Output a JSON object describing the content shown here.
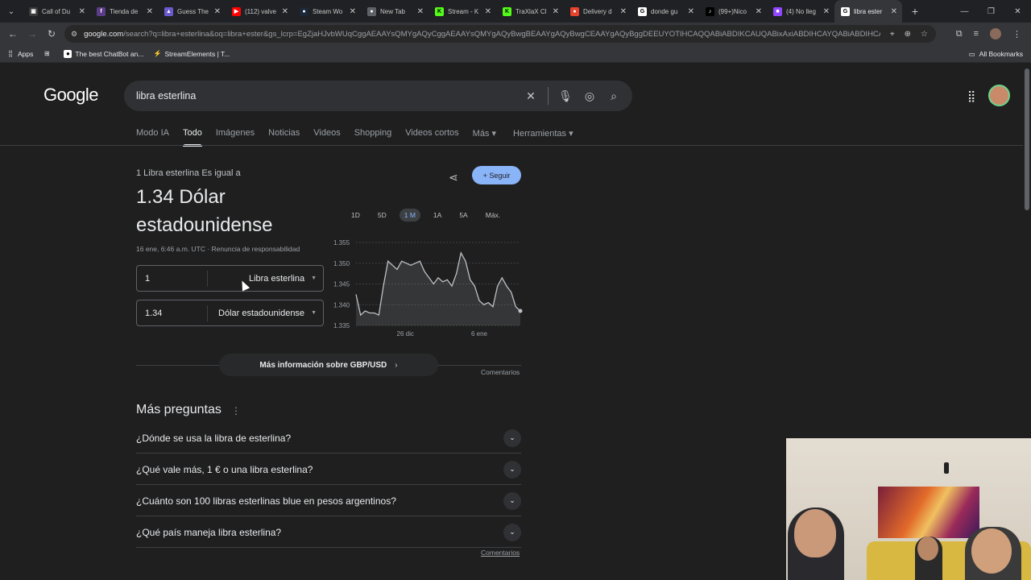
{
  "tabs": [
    {
      "title": "Call of Du",
      "favicon_color": "#3a3a3a",
      "glyph": "▣"
    },
    {
      "title": "Tienda de",
      "favicon_color": "#5b3c88",
      "glyph": "f"
    },
    {
      "title": "Guess The",
      "favicon_color": "#6a5acd",
      "glyph": "▲"
    },
    {
      "title": "(112) valve",
      "favicon_color": "#ff0000",
      "glyph": "▶"
    },
    {
      "title": "Steam Wo",
      "favicon_color": "#1b2838",
      "glyph": "●"
    },
    {
      "title": "New Tab",
      "favicon_color": "#5f6368",
      "glyph": "●"
    },
    {
      "title": "Stream - K",
      "favicon_color": "#53fc18",
      "glyph": "K"
    },
    {
      "title": "TraXlaX Cl",
      "favicon_color": "#53fc18",
      "glyph": "K"
    },
    {
      "title": "Delivery d",
      "favicon_color": "#e8432e",
      "glyph": "●"
    },
    {
      "title": "donde gu",
      "favicon_color": "#ffffff",
      "glyph": "G"
    },
    {
      "title": "(99+)Nico",
      "favicon_color": "#000000",
      "glyph": "♪"
    },
    {
      "title": "(4) No lleg",
      "favicon_color": "#9146ff",
      "glyph": "■"
    },
    {
      "title": "libra ester",
      "favicon_color": "#ffffff",
      "glyph": "G",
      "active": true
    }
  ],
  "toolbar": {
    "url_host": "google.com",
    "url_rest": "/search?q=libra+esterlina&oq=libra+ester&gs_lcrp=EgZjaHJvbWUqCggAEAAYsQMYgAQyCggAEAAYsQMYgAQyBwgBEAAYgAQyBwgCEAAYgAQyBggDEEUYOTIHCAQQABiABDIKCAUQABixAxiABDIHCAYQABiABDIHCAcQABiABDI..."
  },
  "bookmarks": {
    "items": [
      "Apps",
      "The best ChatBot an...",
      "StreamElements | T..."
    ],
    "all_bookmarks": "All Bookmarks"
  },
  "google": {
    "logo": "Google",
    "query": "libra esterlina",
    "nav_tabs": [
      "Modo IA",
      "Todo",
      "Imágenes",
      "Noticias",
      "Videos",
      "Shopping",
      "Videos cortos",
      "Más ▾",
      "Herramientas ▾"
    ],
    "active_tab": "Todo"
  },
  "converter": {
    "subtitle": "1 Libra esterlina Es igual a",
    "result": "1.34 Dólar estadounidense",
    "date_note": "16 ene, 6:46 a.m. UTC · Renuncia de responsabilidad",
    "follow_label": "+ Seguir",
    "from_value": "1",
    "from_currency": "Libra esterlina",
    "to_value": "1.34",
    "to_currency": "Dólar estadounidense",
    "range_tabs": [
      "1D",
      "5D",
      "1 M",
      "1A",
      "5A",
      "Máx."
    ],
    "active_range": "1 M",
    "more_info": "Más información sobre GBP/USD",
    "comments": "Comentarios"
  },
  "chart_data": {
    "type": "area",
    "title": "",
    "y_ticks": [
      "1.355",
      "1.350",
      "1.345",
      "1.340",
      "1.335"
    ],
    "ylim": [
      1.335,
      1.355
    ],
    "x_ticks": [
      "26 dic",
      "6 ene"
    ],
    "values": [
      1.3425,
      1.3375,
      1.3385,
      1.338,
      1.338,
      1.3375,
      1.3445,
      1.3505,
      1.3495,
      1.3485,
      1.3505,
      1.35,
      1.3495,
      1.35,
      1.3505,
      1.348,
      1.3465,
      1.345,
      1.3465,
      1.3455,
      1.346,
      1.3445,
      1.3475,
      1.3525,
      1.3505,
      1.346,
      1.3445,
      1.341,
      1.34,
      1.3405,
      1.3395,
      1.3445,
      1.3465,
      1.3445,
      1.343,
      1.3395,
      1.3385
    ],
    "color": "#bdc1c6"
  },
  "paa": {
    "title": "Más preguntas",
    "questions": [
      "¿Dónde se usa la libra de esterlina?",
      "¿Qué vale más, 1 € o una libra esterlina?",
      "¿Cuánto son 100 libras esterlinas blue en pesos argentinos?",
      "¿Qué país maneja libra esterlina?"
    ],
    "comments": "Comentarios"
  }
}
